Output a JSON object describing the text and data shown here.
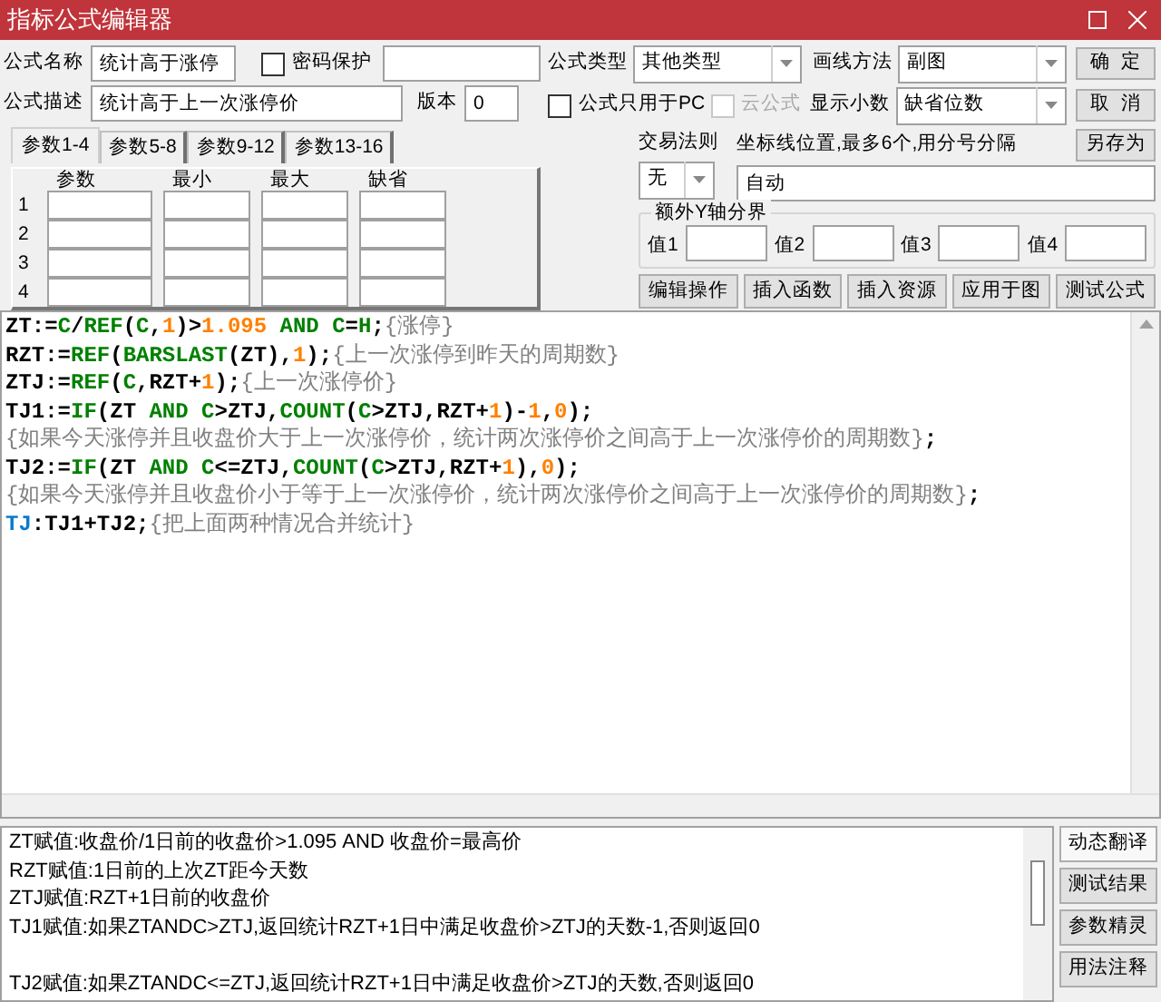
{
  "window": {
    "title": "指标公式编辑器"
  },
  "form": {
    "name_label": "公式名称",
    "name_value": "统计高于涨停",
    "password": {
      "label": "密码保护",
      "checked": false
    },
    "desc_label": "公式描述",
    "desc_value": "统计高于上一次涨停价",
    "version_label": "版本",
    "version_value": "0",
    "type_label": "公式类型",
    "type_value": "其他类型",
    "draw_label": "画线方法",
    "draw_value": "副图",
    "pc_only": {
      "label": "公式只用于PC",
      "checked": false,
      "disabled": false
    },
    "cloud": {
      "label": "云公式",
      "checked": false,
      "disabled": true
    },
    "decimals_label": "显示小数",
    "decimals_value": "缺省位数",
    "trade_rule_label": "交易法则",
    "trade_rule_value": "无",
    "axis_label": "坐标线位置,最多6个,用分号分隔",
    "axis_value": "自动",
    "y_group_title": "额外Y轴分界",
    "y_values": [
      "值1",
      "值2",
      "值3",
      "值4"
    ]
  },
  "side_buttons": [
    "确  定",
    "取  消",
    "另存为"
  ],
  "param_tabs": [
    {
      "label": "参数1-4",
      "selected": true
    },
    {
      "label": "参数5-8",
      "selected": false
    },
    {
      "label": "参数9-12",
      "selected": false
    },
    {
      "label": "参数13-16",
      "selected": false
    }
  ],
  "param_table": {
    "columns": [
      "参数",
      "最小",
      "最大",
      "缺省"
    ],
    "rows": [
      "1",
      "2",
      "3",
      "4"
    ]
  },
  "action_buttons": [
    "编辑操作",
    "插入函数",
    "插入资源",
    "应用于图",
    "测试公式"
  ],
  "code_lines": [
    [
      {
        "kind": "name",
        "text": "ZT:="
      },
      {
        "kind": "func",
        "text": "C"
      },
      {
        "kind": "name",
        "text": "/"
      },
      {
        "kind": "func",
        "text": "REF"
      },
      {
        "kind": "name",
        "text": "("
      },
      {
        "kind": "func",
        "text": "C"
      },
      {
        "kind": "name",
        "text": ","
      },
      {
        "kind": "num",
        "text": "1"
      },
      {
        "kind": "name",
        "text": ")>"
      },
      {
        "kind": "num",
        "text": "1.095"
      },
      {
        "kind": "func",
        "text": " AND "
      },
      {
        "kind": "func",
        "text": "C"
      },
      {
        "kind": "name",
        "text": "="
      },
      {
        "kind": "func",
        "text": "H"
      },
      {
        "kind": "name",
        "text": ";"
      },
      {
        "kind": "comment",
        "text": "{涨停}"
      }
    ],
    [
      {
        "kind": "name",
        "text": "RZT:="
      },
      {
        "kind": "func",
        "text": "REF"
      },
      {
        "kind": "name",
        "text": "("
      },
      {
        "kind": "func",
        "text": "BARSLAST"
      },
      {
        "kind": "name",
        "text": "(ZT),"
      },
      {
        "kind": "num",
        "text": "1"
      },
      {
        "kind": "name",
        "text": ");"
      },
      {
        "kind": "comment",
        "text": "{上一次涨停到昨天的周期数}"
      }
    ],
    [
      {
        "kind": "name",
        "text": "ZTJ:="
      },
      {
        "kind": "func",
        "text": "REF"
      },
      {
        "kind": "name",
        "text": "("
      },
      {
        "kind": "func",
        "text": "C"
      },
      {
        "kind": "name",
        "text": ",RZT+"
      },
      {
        "kind": "num",
        "text": "1"
      },
      {
        "kind": "name",
        "text": ");"
      },
      {
        "kind": "comment",
        "text": "{上一次涨停价}"
      }
    ],
    [
      {
        "kind": "name",
        "text": "TJ1:="
      },
      {
        "kind": "func",
        "text": "IF"
      },
      {
        "kind": "name",
        "text": "(ZT"
      },
      {
        "kind": "func",
        "text": " AND "
      },
      {
        "kind": "func",
        "text": "C"
      },
      {
        "kind": "name",
        "text": ">ZTJ,"
      },
      {
        "kind": "func",
        "text": "COUNT"
      },
      {
        "kind": "name",
        "text": "("
      },
      {
        "kind": "func",
        "text": "C"
      },
      {
        "kind": "name",
        "text": ">ZTJ,RZT+"
      },
      {
        "kind": "num",
        "text": "1"
      },
      {
        "kind": "name",
        "text": ")-"
      },
      {
        "kind": "num",
        "text": "1"
      },
      {
        "kind": "name",
        "text": ","
      },
      {
        "kind": "num",
        "text": "0"
      },
      {
        "kind": "name",
        "text": ");"
      }
    ],
    [
      {
        "kind": "comment",
        "text": "{如果今天涨停并且收盘价大于上一次涨停价，统计两次涨停价之间高于上一次涨停价的周期数}"
      },
      {
        "kind": "name",
        "text": ";"
      }
    ],
    [
      {
        "kind": "name",
        "text": "TJ2:="
      },
      {
        "kind": "func",
        "text": "IF"
      },
      {
        "kind": "name",
        "text": "(ZT"
      },
      {
        "kind": "func",
        "text": " AND "
      },
      {
        "kind": "func",
        "text": "C"
      },
      {
        "kind": "name",
        "text": "<=ZTJ,"
      },
      {
        "kind": "func",
        "text": "COUNT"
      },
      {
        "kind": "name",
        "text": "("
      },
      {
        "kind": "func",
        "text": "C"
      },
      {
        "kind": "name",
        "text": ">ZTJ,RZT+"
      },
      {
        "kind": "num",
        "text": "1"
      },
      {
        "kind": "name",
        "text": "),"
      },
      {
        "kind": "num",
        "text": "0"
      },
      {
        "kind": "name",
        "text": ");"
      }
    ],
    [
      {
        "kind": "comment",
        "text": "{如果今天涨停并且收盘价小于等于上一次涨停价，统计两次涨停价之间高于上一次涨停价的周期数}"
      },
      {
        "kind": "name",
        "text": ";"
      }
    ],
    [
      {
        "kind": "out",
        "text": "TJ"
      },
      {
        "kind": "name",
        "text": ":TJ1+TJ2;"
      },
      {
        "kind": "comment",
        "text": "{把上面两种情况合并统计}"
      }
    ]
  ],
  "translation_paragraphs": [
    [
      "ZT赋值:收盘价/1日前的收盘价>1.095 AND 收盘价=最高价",
      "RZT赋值:1日前的上次ZT距今天数",
      "ZTJ赋值:RZT+1日前的收盘价",
      "TJ1赋值:如果ZTANDC>ZTJ,返回统计RZT+1日中满足收盘价>ZTJ的天数-1,否则返回0"
    ],
    [
      "TJ2赋值:如果ZTANDC<=ZTJ,返回统计RZT+1日中满足收盘价>ZTJ的天数,否则返回0"
    ]
  ],
  "bottom_buttons": [
    {
      "label": "动态翻译",
      "selected": true
    },
    {
      "label": "测试结果",
      "selected": false
    },
    {
      "label": "参数精灵",
      "selected": false
    },
    {
      "label": "用法注释",
      "selected": false
    }
  ]
}
